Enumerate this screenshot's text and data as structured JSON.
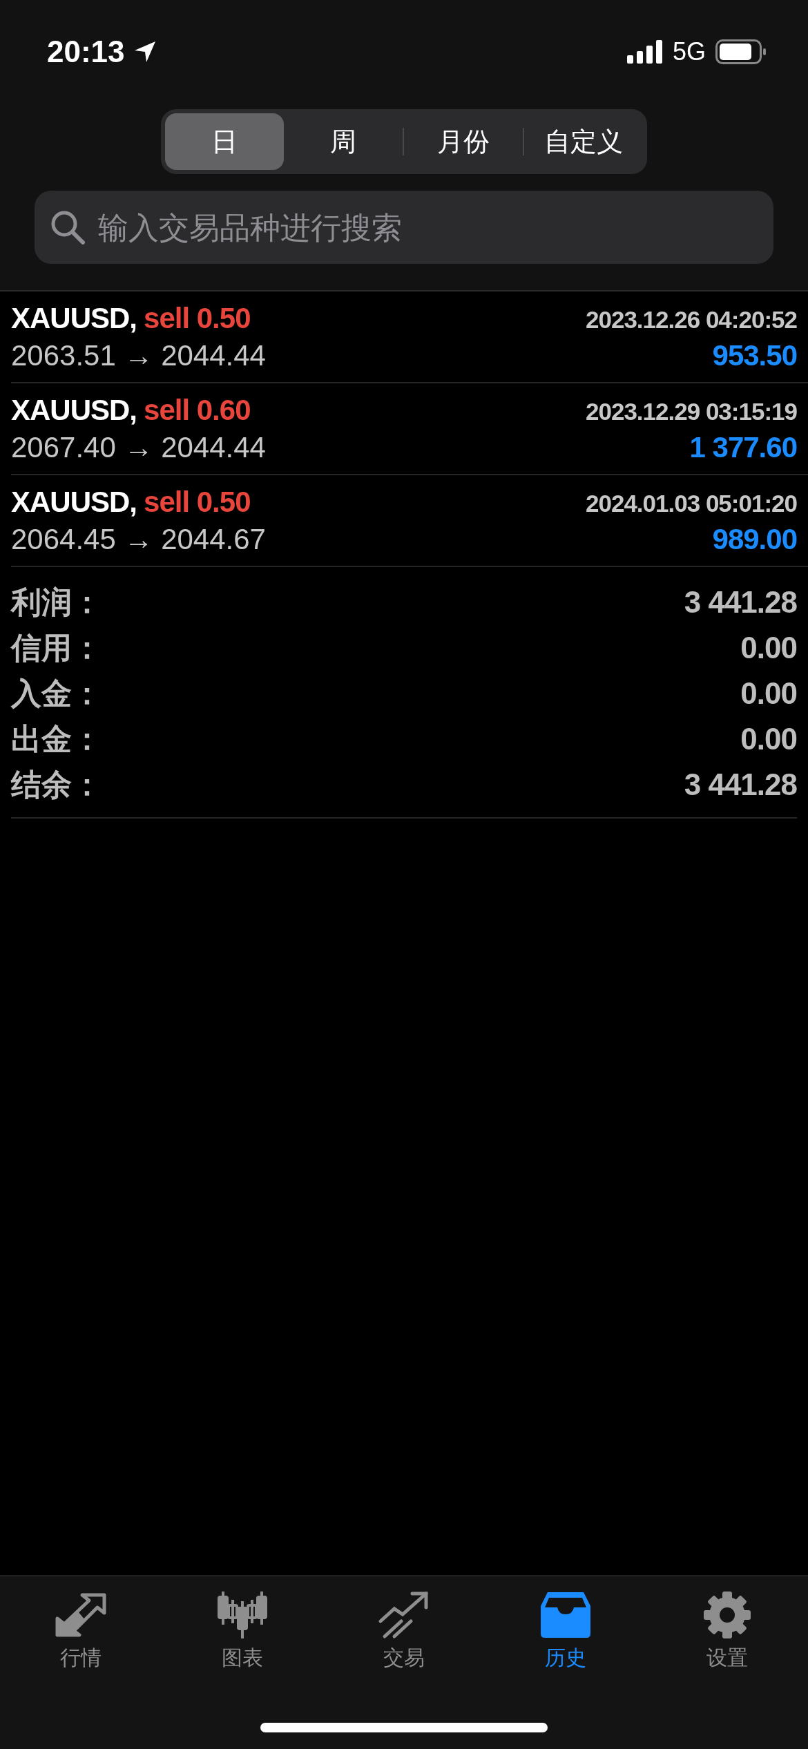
{
  "status_bar": {
    "time": "20:13",
    "network": "5G"
  },
  "periods": [
    {
      "label": "日",
      "selected": true
    },
    {
      "label": "周",
      "selected": false
    },
    {
      "label": "月份",
      "selected": false
    },
    {
      "label": "自定义",
      "selected": false
    }
  ],
  "search": {
    "placeholder": "输入交易品种进行搜索"
  },
  "deals": [
    {
      "symbol": "XAUUSD,",
      "order": "sell 0.50",
      "time": "2023.12.26 04:20:52",
      "prices": "2063.51 → 2044.44",
      "profit": "953.50"
    },
    {
      "symbol": "XAUUSD,",
      "order": "sell 0.60",
      "time": "2023.12.29 03:15:19",
      "prices": "2067.40 → 2044.44",
      "profit": "1 377.60"
    },
    {
      "symbol": "XAUUSD,",
      "order": "sell 0.50",
      "time": "2024.01.03 05:01:20",
      "prices": "2064.45 → 2044.67",
      "profit": "989.00"
    }
  ],
  "summary": [
    {
      "label": "利润：",
      "value": "3 441.28"
    },
    {
      "label": "信用：",
      "value": "0.00"
    },
    {
      "label": "入金：",
      "value": "0.00"
    },
    {
      "label": "出金：",
      "value": "0.00"
    },
    {
      "label": "结余：",
      "value": "3 441.28"
    }
  ],
  "tab_bar": [
    {
      "kind": "quotes",
      "label": "行情",
      "selected": false
    },
    {
      "kind": "chart",
      "label": "图表",
      "selected": false
    },
    {
      "kind": "trade",
      "label": "交易",
      "selected": false
    },
    {
      "kind": "history",
      "label": "历史",
      "selected": true
    },
    {
      "kind": "settings",
      "label": "设置",
      "selected": false
    }
  ]
}
